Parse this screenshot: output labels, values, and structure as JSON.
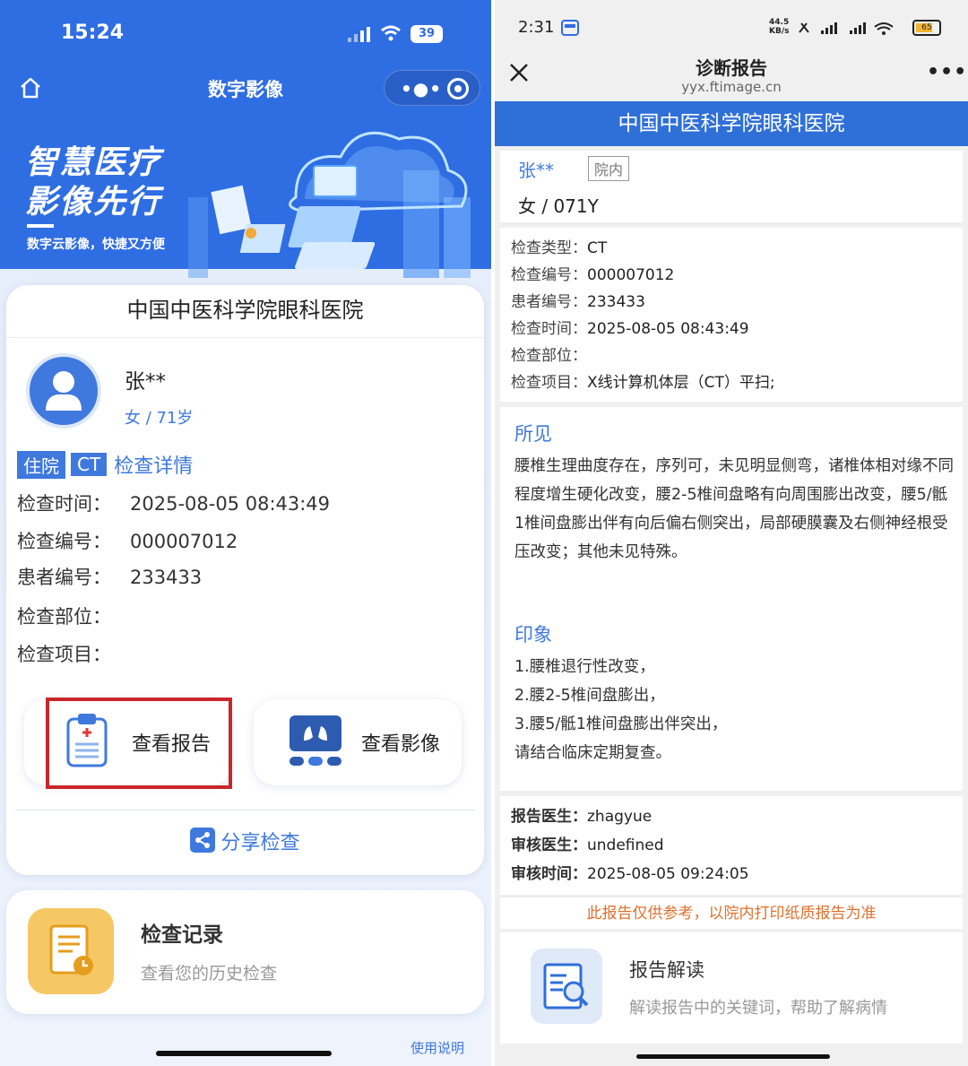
{
  "left": {
    "status": {
      "time": "15:24",
      "battery": "39"
    },
    "nav": {
      "title": "数字影像"
    },
    "banner": {
      "slogan_line1": "智慧医疗",
      "slogan_line2": "影像先行",
      "tagline": "数字云影像，快捷又方便"
    },
    "hospital": "中国中医科学院眼科医院",
    "patient": {
      "name": "张**",
      "sub": "女 / 71岁",
      "tags": [
        "住院",
        "CT"
      ],
      "detail_link": "检查详情",
      "fields": [
        {
          "key": "检查时间：",
          "value": "2025-08-05 08:43:49"
        },
        {
          "key": "检查编号：",
          "value": "000007012"
        },
        {
          "key": "患者编号：",
          "value": "233433"
        },
        {
          "key": "检查部位：",
          "value": ""
        },
        {
          "key": "检查项目：",
          "value": ""
        }
      ]
    },
    "buttons": {
      "view_report": "查看报告",
      "view_image": "查看影像"
    },
    "share": "分享检查",
    "records": {
      "title": "检查记录",
      "subtitle": "查看您的历史检查"
    },
    "usage": "使用说明",
    "colors": {
      "primary": "#2f6de3",
      "highlight": "#c9262c"
    }
  },
  "right": {
    "status": {
      "time": "2:31",
      "speed_top": "44.5",
      "speed_bottom": "KB/s",
      "battery": "65"
    },
    "nav": {
      "title": "诊断报告",
      "url": "yyx.ftimage.cn"
    },
    "hospital": "中国中医科学院眼科医院",
    "patient": {
      "name": "张**",
      "badge": "院内",
      "sub": "女 / 071Y"
    },
    "exam": [
      {
        "key": "检查类型：",
        "value": "CT"
      },
      {
        "key": "检查编号：",
        "value": "000007012"
      },
      {
        "key": "患者编号：",
        "value": "233433"
      },
      {
        "key": "检查时间：",
        "value": "2025-08-05 08:43:49"
      },
      {
        "key": "检查部位：",
        "value": ""
      },
      {
        "key": "检查项目：",
        "value": "X线计算机体层（CT）平扫;"
      }
    ],
    "findings": {
      "title": "所见",
      "text": "腰椎生理曲度存在，序列可，未见明显侧弯，诸椎体相对缘不同程度增生硬化改变，腰2-5椎间盘略有向周围膨出改变，腰5/骶1椎间盘膨出伴有向后偏右侧突出，局部硬膜囊及右侧神经根受压改变；其他未见特殊。"
    },
    "impression": {
      "title": "印象",
      "lines": [
        "1.腰椎退行性改变，",
        "2.腰2-5椎间盘膨出，",
        "3.腰5/骶1椎间盘膨出伴突出，",
        "请结合临床定期复查。"
      ]
    },
    "doctors": [
      {
        "key": "报告医生：",
        "value": "zhagyue"
      },
      {
        "key": "审核医生：",
        "value": "undefined"
      },
      {
        "key": "审核时间：",
        "value": "2025-08-05 09:24:05"
      }
    ],
    "note": "此报告仅供参考，以院内打印纸质报告为准",
    "interpret": {
      "title": "报告解读",
      "subtitle": "解读报告中的关键词，帮助了解病情"
    },
    "colors": {
      "primary": "#2f6fd8",
      "note": "#e0702c"
    }
  }
}
